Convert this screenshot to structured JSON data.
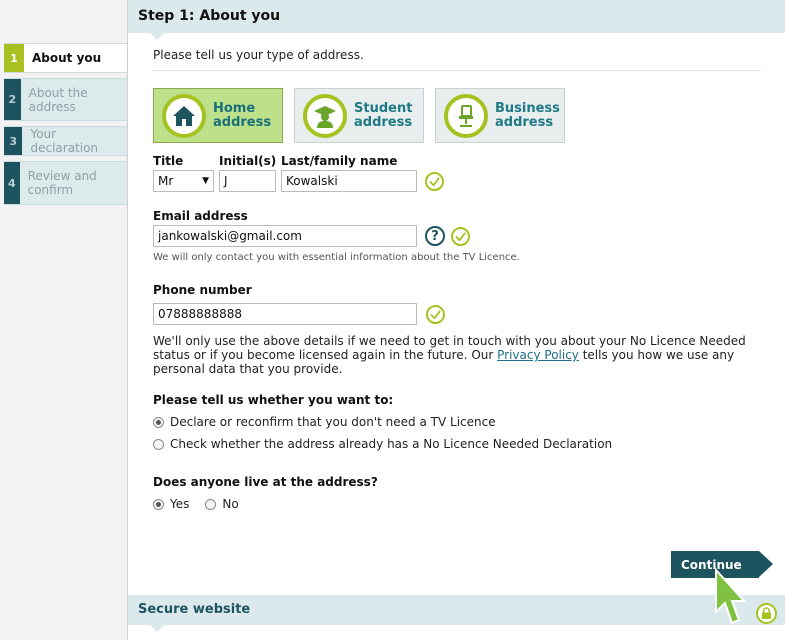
{
  "sidebar": {
    "steps": [
      {
        "num": "1",
        "label": "About you"
      },
      {
        "num": "2",
        "label": "About the address"
      },
      {
        "num": "3",
        "label": "Your declaration"
      },
      {
        "num": "4",
        "label": "Review and confirm"
      }
    ]
  },
  "header": {
    "title": "Step 1: About you"
  },
  "intro": "Please tell us your type of address.",
  "address_types": [
    {
      "label_line1": "Home",
      "label_line2": "address",
      "icon": "house-icon",
      "selected": true
    },
    {
      "label_line1": "Student",
      "label_line2": "address",
      "icon": "graduate-icon",
      "selected": false
    },
    {
      "label_line1": "Business",
      "label_line2": "address",
      "icon": "office-chair-icon",
      "selected": false
    }
  ],
  "name": {
    "title_label": "Title",
    "title_value": "Mr",
    "initials_label": "Initial(s)",
    "initials_value": "J",
    "lastname_label": "Last/family name",
    "lastname_value": "Kowalski"
  },
  "email": {
    "label": "Email address",
    "value": "jankowalski@gmail.com",
    "help_symbol": "?",
    "note": "We will only contact you with essential information about the TV Licence."
  },
  "phone": {
    "label": "Phone number",
    "value": "07888888888",
    "note_before": "We'll only use the above details if we need to get in touch with you about your No Licence Needed status or if you become licensed again in the future. Our ",
    "privacy_link": "Privacy Policy",
    "note_after": " tells you how we use any personal data that you provide."
  },
  "intent": {
    "question": "Please tell us whether you want to:",
    "option1": "Declare or reconfirm that you don't need a TV Licence",
    "option2": "Check whether the address already has a No Licence Needed Declaration"
  },
  "occupancy": {
    "question": "Does anyone live at the address?",
    "yes": "Yes",
    "no": "No"
  },
  "continue_label": "Continue",
  "footer": {
    "label": "Secure website"
  },
  "colors": {
    "accent_green": "#a4c31f",
    "dark_teal": "#1e5460",
    "header_bg": "#dce9ec"
  }
}
